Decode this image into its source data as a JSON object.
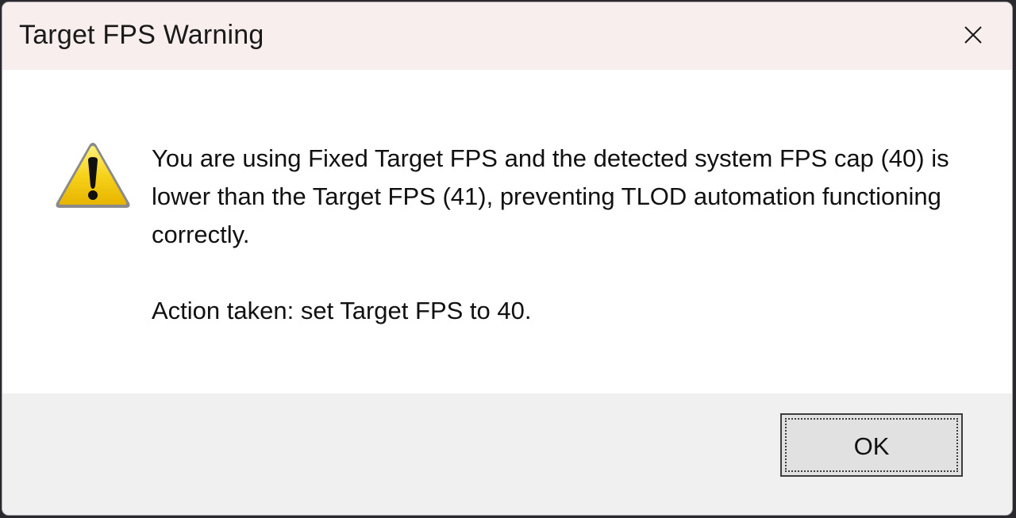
{
  "window": {
    "title": "Target FPS Warning",
    "close_icon": "close-icon"
  },
  "message": {
    "icon": "warning-icon",
    "body": "You are using Fixed Target FPS and the detected system FPS cap (40) is lower than the Target FPS (41), preventing TLOD automation functioning correctly.",
    "action": "Action taken: set Target FPS to 40."
  },
  "buttons": {
    "ok_label": "OK"
  },
  "colors": {
    "titlebar": "#f8eeee",
    "content": "#ffffff",
    "footer": "#f0f0f0",
    "button": "#e1e1e1",
    "warning_yellow": "#f5c400"
  }
}
